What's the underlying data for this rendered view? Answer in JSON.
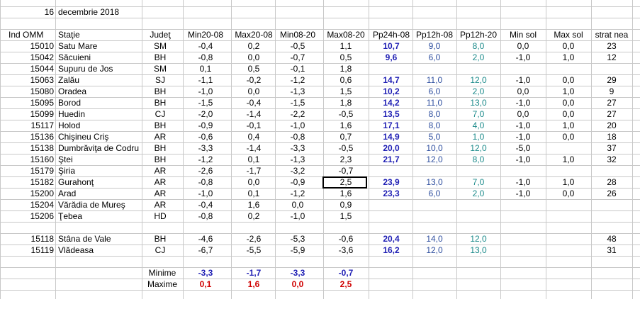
{
  "date": {
    "day": "16",
    "month_year": "decembrie 2018"
  },
  "headers": {
    "ind": "Ind OMM",
    "statie": "Staţie",
    "judet": "Judeţ",
    "min2008": "Min20-08",
    "max2008": "Max20-08",
    "min0820": "Min08-20",
    "max0820": "Max08-20",
    "pp24": "Pp24h-08",
    "pp12_08": "Pp12h-08",
    "pp12_20": "Pp12h-20",
    "minsol": "Min sol",
    "maxsol": "Max sol",
    "strat": "strat nea"
  },
  "rows": [
    {
      "ind": "15010",
      "statie": "Satu Mare",
      "judet": "SM",
      "min2008": "-0,4",
      "max2008": "0,2",
      "min0820": "-0,5",
      "max0820": "1,1",
      "pp24": "10,7",
      "pp12_08": "9,0",
      "pp12_20": "8,0",
      "minsol": "0,0",
      "maxsol": "0,0",
      "strat": "23"
    },
    {
      "ind": "15042",
      "statie": "Săcuieni",
      "judet": "BH",
      "min2008": "-0,8",
      "max2008": "0,0",
      "min0820": "-0,7",
      "max0820": "0,5",
      "pp24": "9,6",
      "pp12_08": "6,0",
      "pp12_20": "2,0",
      "minsol": "-1,0",
      "maxsol": "1,0",
      "strat": "12"
    },
    {
      "ind": "15044",
      "statie": "Supuru de Jos",
      "judet": "SM",
      "min2008": "0,1",
      "max2008": "0,5",
      "min0820": "-0,1",
      "max0820": "1,8",
      "pp24": "",
      "pp12_08": "",
      "pp12_20": "",
      "minsol": "",
      "maxsol": "",
      "strat": ""
    },
    {
      "ind": "15063",
      "statie": "Zalău",
      "judet": "SJ",
      "min2008": "-1,1",
      "max2008": "-0,2",
      "min0820": "-1,2",
      "max0820": "0,6",
      "pp24": "14,7",
      "pp12_08": "11,0",
      "pp12_20": "12,0",
      "minsol": "-1,0",
      "maxsol": "0,0",
      "strat": "29"
    },
    {
      "ind": "15080",
      "statie": "Oradea",
      "judet": "BH",
      "min2008": "-1,0",
      "max2008": "0,0",
      "min0820": "-1,3",
      "max0820": "1,5",
      "pp24": "10,2",
      "pp12_08": "6,0",
      "pp12_20": "2,0",
      "minsol": "0,0",
      "maxsol": "1,0",
      "strat": "9"
    },
    {
      "ind": "15095",
      "statie": "Borod",
      "judet": "BH",
      "min2008": "-1,5",
      "max2008": "-0,4",
      "min0820": "-1,5",
      "max0820": "1,8",
      "pp24": "14,2",
      "pp12_08": "11,0",
      "pp12_20": "13,0",
      "minsol": "-1,0",
      "maxsol": "0,0",
      "strat": "27"
    },
    {
      "ind": "15099",
      "statie": "Huedin",
      "judet": "CJ",
      "min2008": "-2,0",
      "max2008": "-1,4",
      "min0820": "-2,2",
      "max0820": "-0,5",
      "pp24": "13,5",
      "pp12_08": "8,0",
      "pp12_20": "7,0",
      "minsol": "0,0",
      "maxsol": "0,0",
      "strat": "27"
    },
    {
      "ind": "15117",
      "statie": "Holod",
      "judet": "BH",
      "min2008": "-0,9",
      "max2008": "-0,1",
      "min0820": "-1,0",
      "max0820": "1,6",
      "pp24": "17,1",
      "pp12_08": "8,0",
      "pp12_20": "4,0",
      "minsol": "-1,0",
      "maxsol": "1,0",
      "strat": "20"
    },
    {
      "ind": "15136",
      "statie": "Chişineu    Criş",
      "judet": "AR",
      "min2008": "-0,6",
      "max2008": "0,4",
      "min0820": "-0,8",
      "max0820": "0,7",
      "pp24": "14,9",
      "pp12_08": "5,0",
      "pp12_20": "1,0",
      "minsol": "-1,0",
      "maxsol": "0,0",
      "strat": "18"
    },
    {
      "ind": "15138",
      "statie": "Dumbrăviţa de Codru",
      "judet": "BH",
      "min2008": "-3,3",
      "max2008": "-1,4",
      "min0820": "-3,3",
      "max0820": "-0,5",
      "pp24": "20,0",
      "pp12_08": "10,0",
      "pp12_20": "12,0",
      "minsol": "-5,0",
      "maxsol": "",
      "strat": "37"
    },
    {
      "ind": "15160",
      "statie": "Ştei",
      "judet": "BH",
      "min2008": "-1,2",
      "max2008": "0,1",
      "min0820": "-1,3",
      "max0820": "2,3",
      "pp24": "21,7",
      "pp12_08": "12,0",
      "pp12_20": "8,0",
      "minsol": "-1,0",
      "maxsol": "1,0",
      "strat": "32"
    },
    {
      "ind": "15179",
      "statie": "Şiria",
      "judet": "AR",
      "min2008": "-2,6",
      "max2008": "-1,7",
      "min0820": "-3,2",
      "max0820": "-0,7",
      "pp24": "",
      "pp12_08": "",
      "pp12_20": "",
      "minsol": "",
      "maxsol": "",
      "strat": ""
    },
    {
      "ind": "15182",
      "statie": "Gurahonţ",
      "judet": "AR",
      "min2008": "-0,8",
      "max2008": "0,0",
      "min0820": "-0,9",
      "max0820": "2,5",
      "pp24": "23,9",
      "pp12_08": "13,0",
      "pp12_20": "7,0",
      "minsol": "-1,0",
      "maxsol": "1,0",
      "strat": "28"
    },
    {
      "ind": "15200",
      "statie": "Arad",
      "judet": "AR",
      "min2008": "-1,0",
      "max2008": "0,1",
      "min0820": "-1,2",
      "max0820": "1,6",
      "pp24": "23,3",
      "pp12_08": "6,0",
      "pp12_20": "2,0",
      "minsol": "-1,0",
      "maxsol": "0,0",
      "strat": "26"
    },
    {
      "ind": "15204",
      "statie": "Vărădia de Mureş",
      "judet": "AR",
      "min2008": "-0,4",
      "max2008": "1,6",
      "min0820": "0,0",
      "max0820": "0,9",
      "pp24": "",
      "pp12_08": "",
      "pp12_20": "",
      "minsol": "",
      "maxsol": "",
      "strat": ""
    },
    {
      "ind": "15206",
      "statie": "Ţebea",
      "judet": "HD",
      "min2008": "-0,8",
      "max2008": "0,2",
      "min0820": "-1,0",
      "max0820": "1,5",
      "pp24": "",
      "pp12_08": "",
      "pp12_20": "",
      "minsol": "",
      "maxsol": "",
      "strat": ""
    },
    {
      "ind": "15118",
      "statie": "Stâna de Vale",
      "judet": "BH",
      "min2008": "-4,6",
      "max2008": "-2,6",
      "min0820": "-5,3",
      "max0820": "-0,6",
      "pp24": "20,4",
      "pp12_08": "14,0",
      "pp12_20": "12,0",
      "minsol": "",
      "maxsol": "",
      "strat": "48"
    },
    {
      "ind": "15119",
      "statie": "Vlădeasa",
      "judet": "CJ",
      "min2008": "-6,7",
      "max2008": "-5,5",
      "min0820": "-5,9",
      "max0820": "-3,6",
      "pp24": "16,2",
      "pp12_08": "12,0",
      "pp12_20": "13,0",
      "minsol": "",
      "maxsol": "",
      "strat": "31"
    }
  ],
  "summary": {
    "minime": {
      "label": "Minime",
      "min2008": "-3,3",
      "max2008": "-1,7",
      "min0820": "-3,3",
      "max0820": "-0,7"
    },
    "maxime": {
      "label": "Maxime",
      "min2008": "0,1",
      "max2008": "1,6",
      "min0820": "0,0",
      "max0820": "2,5"
    }
  },
  "colors": {
    "bold_precip": "#1f1fb4",
    "pp12_08": "#2f4f9f",
    "pp12_20": "#1b8a8a",
    "maxime": "#d00000",
    "minime": "#1f1fb4"
  }
}
